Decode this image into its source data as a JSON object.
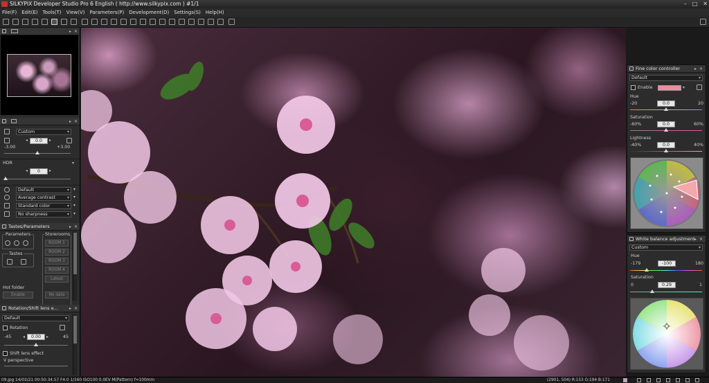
{
  "window": {
    "title": "SILKYPIX Developer Studio Pro 6 English ( http://www.silkypix.com )  #1/1"
  },
  "menu": [
    {
      "label": "File(F)"
    },
    {
      "label": "Edit(E)"
    },
    {
      "label": "Tools(T)"
    },
    {
      "label": "View(V)"
    },
    {
      "label": "Parameters(P)"
    },
    {
      "label": "Development(D)"
    },
    {
      "label": "Settings(S)"
    },
    {
      "label": "Help(H)"
    }
  ],
  "left": {
    "exposure": {
      "preset": "Custom",
      "value": "0.0",
      "min": "-3.00",
      "max": "+3.00"
    },
    "hdr": {
      "label": "HDR",
      "value": "0"
    },
    "presets": {
      "white_balance": "Default",
      "contrast": "Average contrast",
      "color": "Standard color",
      "sharpness": "No sharpness"
    },
    "tastes": {
      "header": "Tastes/Parameters",
      "parameters_label": "Parameters",
      "tastes_label": "Tastes",
      "storerooms_label": "Storerooms",
      "rooms": [
        "ROOM 1",
        "ROOM 2",
        "ROOM 3",
        "ROOM 4"
      ],
      "latest": "Latest",
      "hot_folder": "Hot folder",
      "enable": "Enable",
      "no_data": "No data"
    },
    "rotation": {
      "header": "Rotation/Shift lens e...",
      "preset": "Default",
      "rotation_label": "Rotation",
      "min": "-45",
      "max": "45",
      "value": "0.00",
      "shift_label": "Shift lens effect",
      "vperspective": "V perspective"
    }
  },
  "fine_color": {
    "header": "Fine color controller",
    "preset": "Default",
    "enable": "Enable",
    "swatch_color": "#f08aa0",
    "hue": {
      "label": "Hue",
      "min": "-20",
      "max": "20",
      "value": "0.0"
    },
    "saturation": {
      "label": "Saturation",
      "min": "-60%",
      "max": "60%",
      "value": "0.0"
    },
    "lightness": {
      "label": "Lightness",
      "min": "-40%",
      "max": "40%",
      "value": "0.0"
    }
  },
  "white_balance": {
    "header": "White balance adjustment",
    "preset": "Custom",
    "hue": {
      "label": "Hue",
      "min": "-179",
      "max": "180",
      "value": "-100"
    },
    "saturation": {
      "label": "Saturation",
      "min": "0",
      "max": "1",
      "value": "0.29"
    }
  },
  "status": {
    "left": "09.jpg 14/03/21 00:50:34.57 F4.0 1/160 ISO100  0.0EV M(Pattern) f=100mm",
    "right": "(2901, 504) R:153 G:194 B:171"
  }
}
